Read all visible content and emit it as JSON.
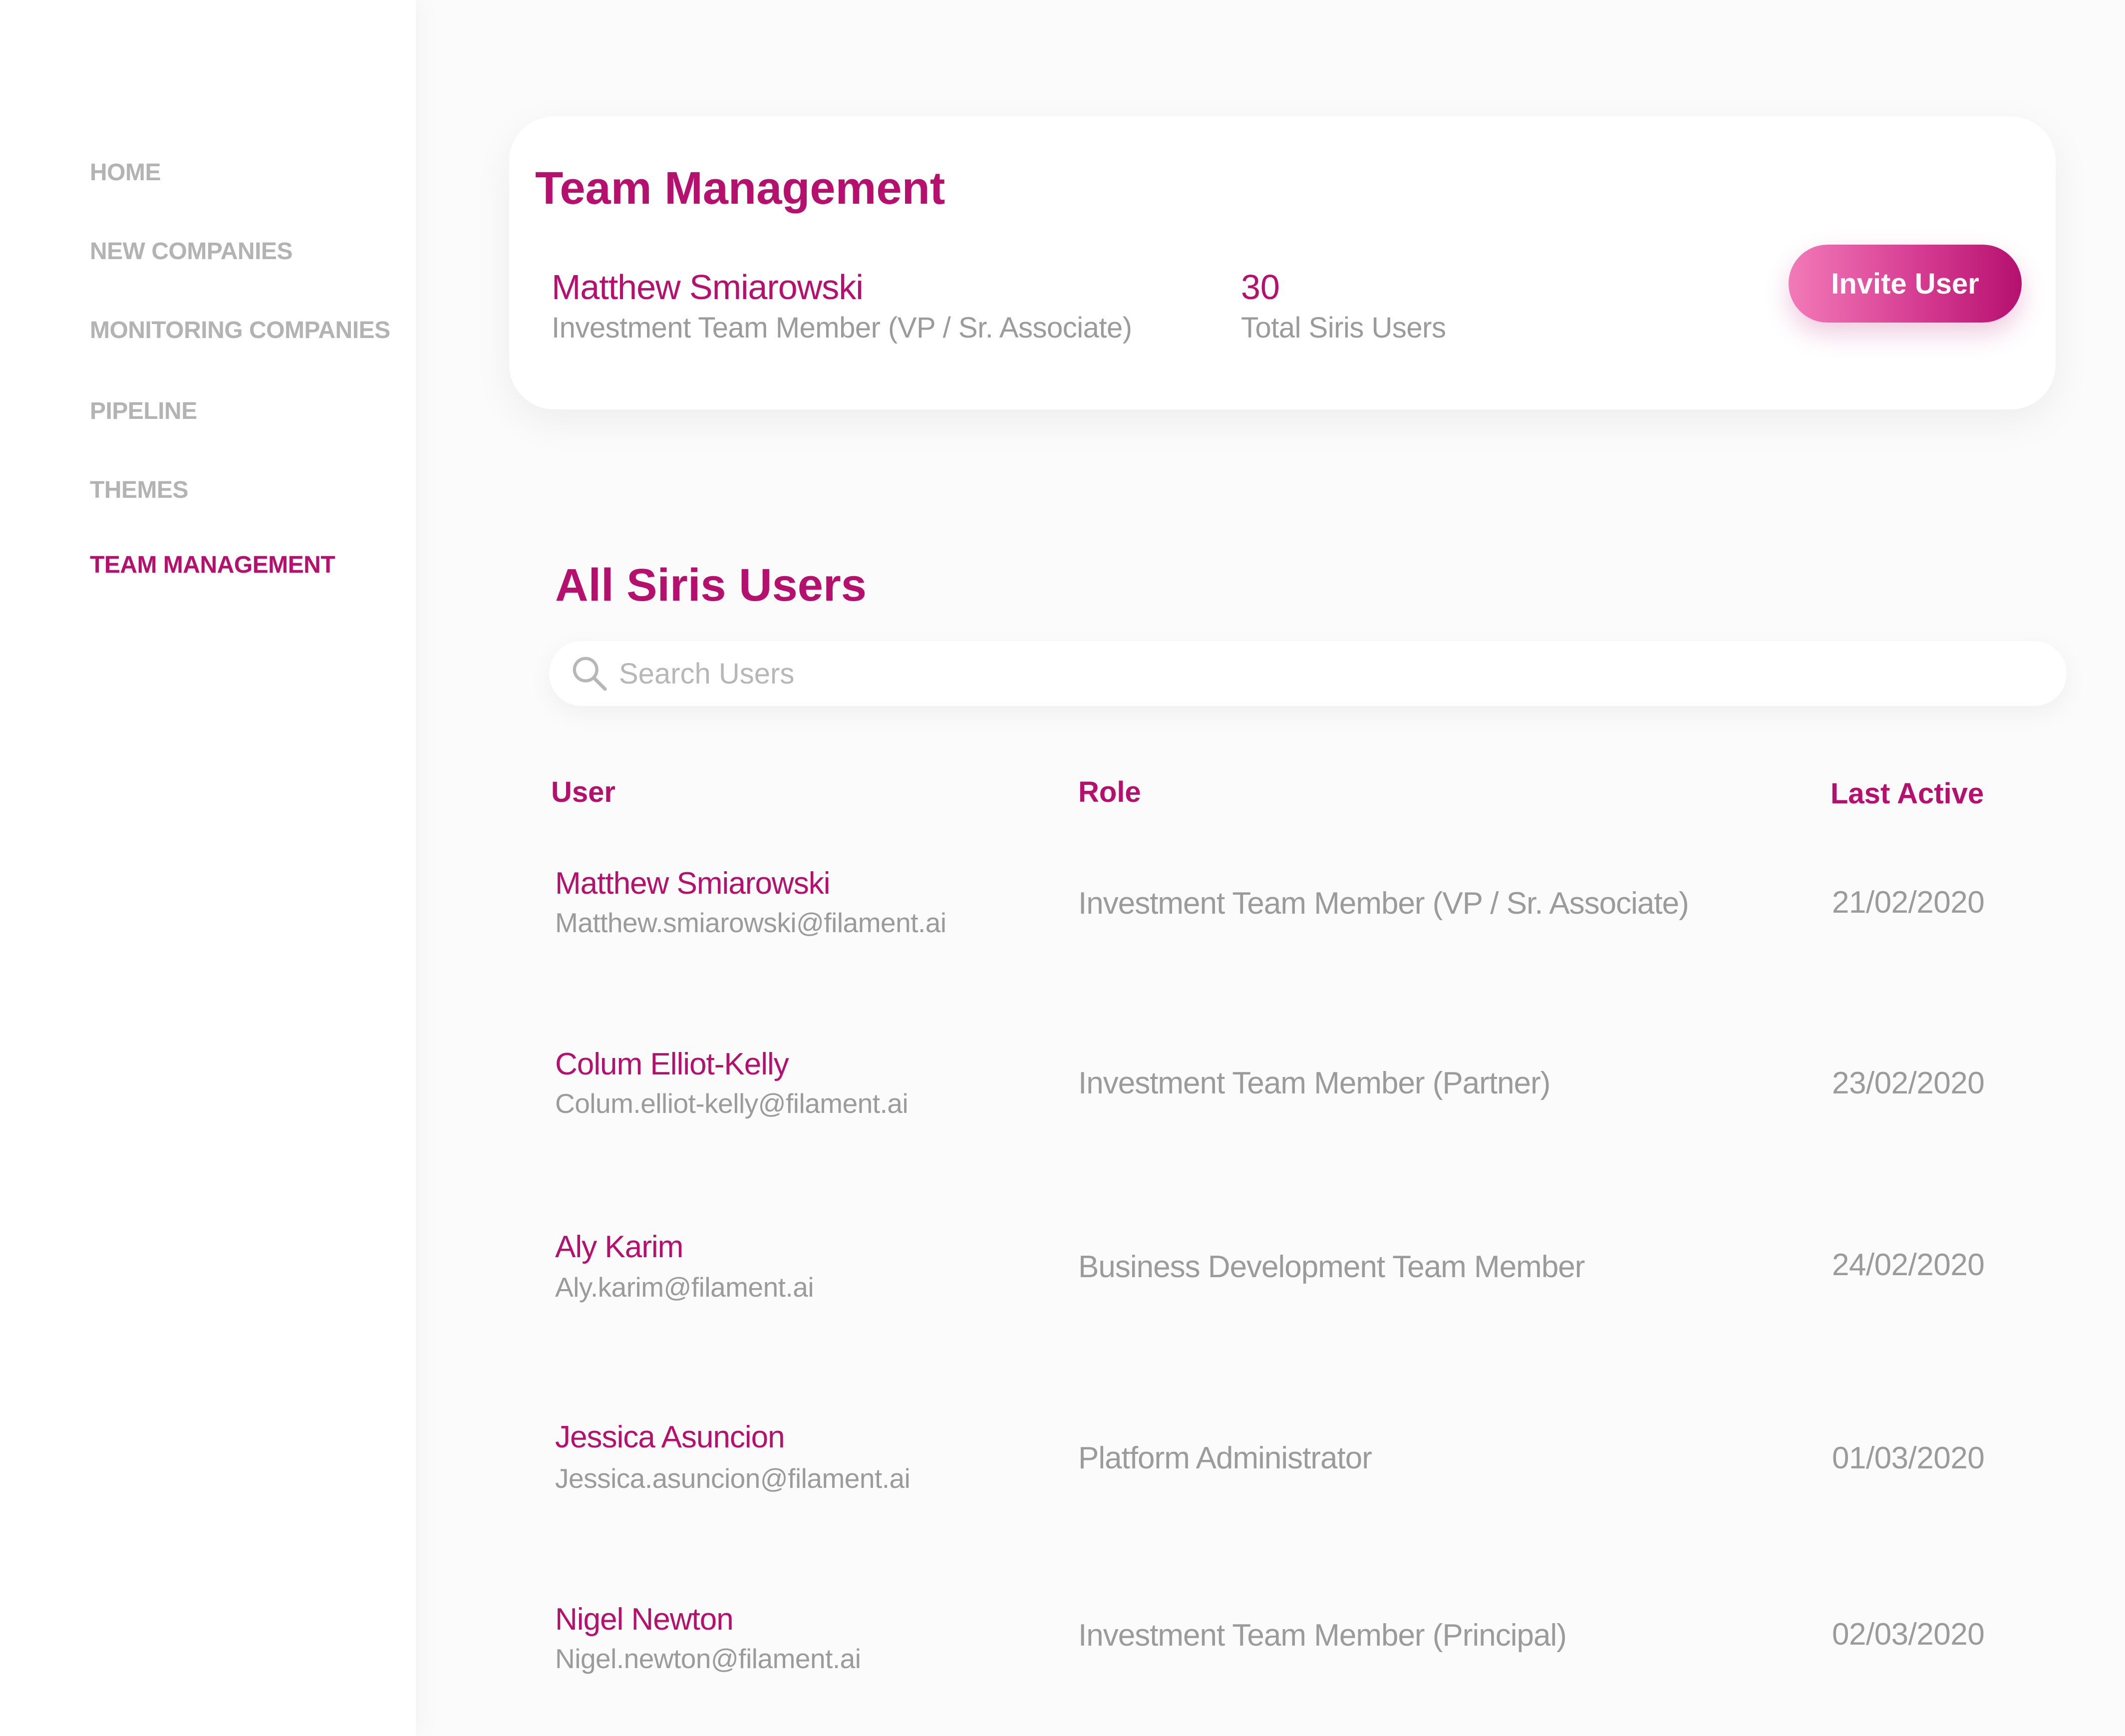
{
  "sidebar": {
    "items": [
      {
        "label": "HOME"
      },
      {
        "label": "NEW COMPANIES"
      },
      {
        "label": "MONITORING COMPANIES"
      },
      {
        "label": "PIPELINE"
      },
      {
        "label": "THEMES"
      },
      {
        "label": "TEAM MANAGEMENT",
        "active": true
      }
    ]
  },
  "summary": {
    "title": "Team Management",
    "current_user_name": "Matthew Smiarowski",
    "current_user_role": "Investment Team Member (VP / Sr. Associate)",
    "total_users": "30",
    "total_users_label": "Total Siris Users",
    "invite_label": "Invite User"
  },
  "users_section": {
    "title": "All Siris Users",
    "search_placeholder": "Search Users",
    "search_icon": "search-icon",
    "columns": {
      "user": "User",
      "role": "Role",
      "last_active": "Last Active"
    }
  },
  "users": [
    {
      "name": "Matthew Smiarowski",
      "email": "Matthew.smiarowski@filament.ai",
      "role": "Investment Team Member (VP / Sr. Associate)",
      "last_active": "21/02/2020"
    },
    {
      "name": "Colum Elliot-Kelly",
      "email": "Colum.elliot-kelly@filament.ai",
      "role": "Investment Team Member (Partner)",
      "last_active": "23/02/2020"
    },
    {
      "name": "Aly Karim",
      "email": "Aly.karim@filament.ai",
      "role": "Business Development Team Member",
      "last_active": "24/02/2020"
    },
    {
      "name": "Jessica Asuncion",
      "email": "Jessica.asuncion@filament.ai",
      "role": "Platform Administrator",
      "last_active": "01/03/2020"
    },
    {
      "name": "Nigel Newton",
      "email": "Nigel.newton@filament.ai",
      "role": "Investment Team Member (Principal)",
      "last_active": "02/03/2020"
    }
  ],
  "colors": {
    "accent": "#b5106e",
    "muted_text": "#9b9b9b",
    "nav_inactive": "#b3b3b3",
    "button_gradient_start": "#f27ab8"
  }
}
